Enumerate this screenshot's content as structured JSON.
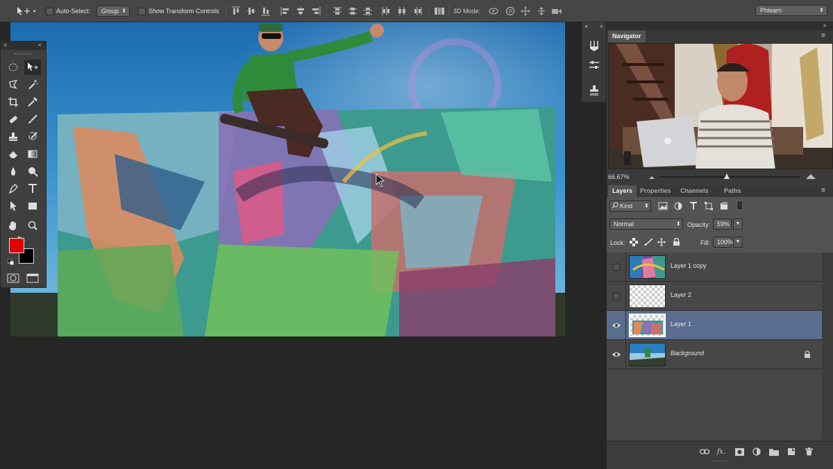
{
  "options_bar": {
    "auto_select_label": "Auto-Select:",
    "auto_select_value": "Group",
    "show_transform_label": "Show Transform Controls",
    "mode_3d_label": "3D Mode:",
    "workspace_value": "Phlearn"
  },
  "navigator": {
    "title": "Navigator",
    "zoom": "66.67%"
  },
  "layers_panel": {
    "tabs": [
      "Layers",
      "Properties",
      "Channels",
      "Paths"
    ],
    "filter_kind": "Kind",
    "blend_mode": "Normal",
    "opacity_label": "Opacity:",
    "opacity_value": "59%",
    "lock_label": "Lock:",
    "fill_label": "Fill:",
    "fill_value": "100%",
    "layers": [
      {
        "name": "Layer 1 copy",
        "visible": false,
        "selected": false
      },
      {
        "name": "Layer 2",
        "visible": false,
        "selected": false
      },
      {
        "name": "Layer 1",
        "visible": true,
        "selected": true
      },
      {
        "name": "Background",
        "visible": true,
        "selected": false,
        "locked": true
      }
    ]
  },
  "colors": {
    "foreground": "#e00000",
    "background": "#000000",
    "selection": "#5a6d8f"
  },
  "icons": [
    "move-tool-icon",
    "marquee-icon",
    "lasso-icon",
    "crop-icon",
    "brush-icon",
    "type-icon",
    "hand-icon",
    "zoom-icon",
    "eye-icon",
    "lock-icon",
    "link-icon",
    "fx-icon",
    "mask-icon",
    "folder-icon",
    "new-layer-icon",
    "trash-icon"
  ]
}
